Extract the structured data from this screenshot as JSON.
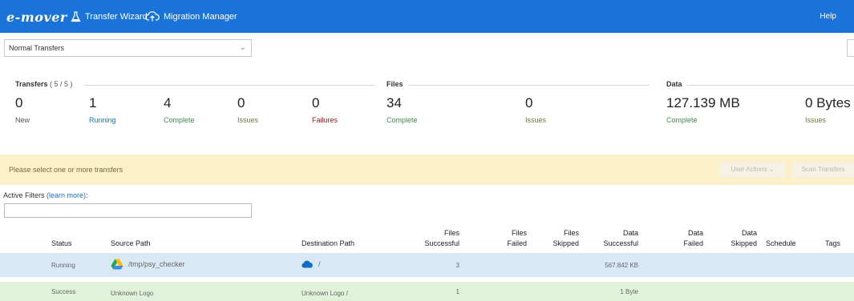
{
  "nav": {
    "logo": "e-mover",
    "items": [
      "Transfer Wizard",
      "Migration Manager"
    ],
    "help": "Help"
  },
  "dropdown": {
    "selected": "Normal Transfers"
  },
  "stats": {
    "transfers": {
      "title": "Transfers",
      "count": "( 5 / 5 )",
      "items": [
        {
          "value": "0",
          "label": "New"
        },
        {
          "value": "1",
          "label": "Running"
        },
        {
          "value": "4",
          "label": "Complete"
        },
        {
          "value": "0",
          "label": "Issues"
        },
        {
          "value": "0",
          "label": "Failures"
        }
      ]
    },
    "files": {
      "title": "Files",
      "items": [
        {
          "value": "34",
          "label": "Complete"
        },
        {
          "value": "0",
          "label": "Issues"
        }
      ]
    },
    "data": {
      "title": "Data",
      "items": [
        {
          "value": "127.139 MB",
          "label": "Complete"
        },
        {
          "value": "0 Bytes",
          "label": "Issues"
        }
      ]
    }
  },
  "alert": {
    "message": "Please select one or more transfers",
    "user_actions": "User Actions",
    "scan_transfers": "Scan Transfers"
  },
  "filters": {
    "label": "Active Filters",
    "link": "(learn more)",
    "colon": ":",
    "value": ""
  },
  "table": {
    "columns": [
      {
        "l1": "",
        "l2": "Status"
      },
      {
        "l1": "",
        "l2": "Source Path"
      },
      {
        "l1": "",
        "l2": "Destination Path"
      },
      {
        "l1": "Files",
        "l2": "Successful"
      },
      {
        "l1": "Files",
        "l2": "Failed"
      },
      {
        "l1": "Files",
        "l2": "Skipped"
      },
      {
        "l1": "Data",
        "l2": "Successful"
      },
      {
        "l1": "Data",
        "l2": "Failed"
      },
      {
        "l1": "Data",
        "l2": "Skipped"
      },
      {
        "l1": "",
        "l2": "Schedule"
      },
      {
        "l1": "",
        "l2": "Tags"
      }
    ],
    "rows": [
      {
        "status": "Running",
        "source": "/tmp/psy_checker",
        "source_icon": "google-drive-icon",
        "destination": "/",
        "destination_icon": "onedrive-cloud-icon",
        "files_successful": "3",
        "data_successful": "567.842 KB"
      },
      {
        "status": "Success",
        "source": "Unknown Logo",
        "destination": "Unknown Logo /",
        "files_successful": "1",
        "data_successful": "1 Byte"
      }
    ]
  },
  "colors": {
    "nav": "#1a73d9",
    "alert": "#fbf0c7",
    "row_running": "#d8e9f5",
    "row_success": "#e0f2da"
  }
}
